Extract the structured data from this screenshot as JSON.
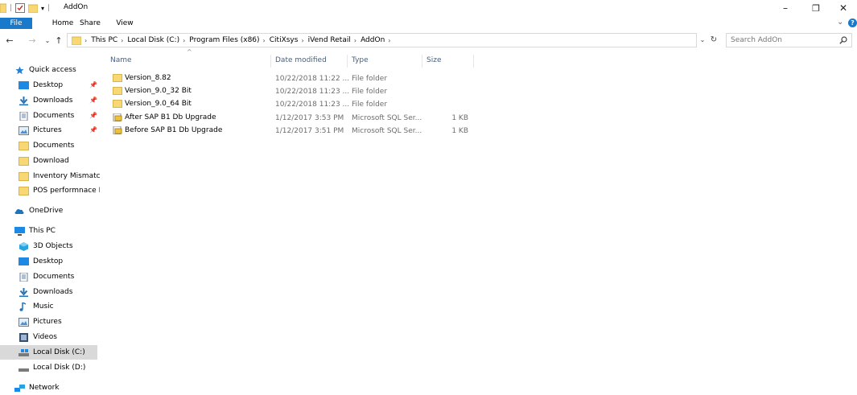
{
  "window": {
    "title": "AddOn",
    "minimize": "–",
    "maximize": "❐",
    "close": "✕"
  },
  "ribbon": {
    "tabs": [
      "File",
      "Home",
      "Share",
      "View"
    ],
    "expand": "⌄",
    "help": "?"
  },
  "nav": {
    "back": "←",
    "forward": "→",
    "recent": "⌄",
    "up": "↑"
  },
  "address": {
    "crumbs": [
      "This PC",
      "Local Disk (C:)",
      "Program Files (x86)",
      "CitiXsys",
      "iVend Retail",
      "AddOn"
    ],
    "sep": "›",
    "dropdown": "⌄",
    "refresh": "↻"
  },
  "search": {
    "placeholder": "Search AddOn",
    "value": ""
  },
  "sidebar": {
    "items": [
      {
        "label": "Quick access",
        "icon": "star-icon",
        "pin": ""
      },
      {
        "label": "Desktop",
        "icon": "desktop-icon",
        "pin": "📌"
      },
      {
        "label": "Downloads",
        "icon": "download-icon",
        "pin": "📌"
      },
      {
        "label": "Documents",
        "icon": "documents-icon",
        "pin": "📌"
      },
      {
        "label": "Pictures",
        "icon": "pictures-icon",
        "pin": "📌"
      },
      {
        "label": "Documents",
        "icon": "folder-icon",
        "pin": ""
      },
      {
        "label": "Download",
        "icon": "folder-icon",
        "pin": ""
      },
      {
        "label": "Inventory Mismatch",
        "icon": "folder-icon",
        "pin": ""
      },
      {
        "label": "POS performnace Is",
        "icon": "folder-icon",
        "pin": ""
      },
      {
        "label": "OneDrive",
        "icon": "onedrive-icon",
        "pin": ""
      },
      {
        "label": "This PC",
        "icon": "thispc-icon",
        "pin": ""
      },
      {
        "label": "3D Objects",
        "icon": "3d-objects-icon",
        "pin": ""
      },
      {
        "label": "Desktop",
        "icon": "desktop-icon",
        "pin": ""
      },
      {
        "label": "Documents",
        "icon": "documents-icon",
        "pin": ""
      },
      {
        "label": "Downloads",
        "icon": "download-icon",
        "pin": ""
      },
      {
        "label": "Music",
        "icon": "music-icon",
        "pin": ""
      },
      {
        "label": "Pictures",
        "icon": "pictures-icon",
        "pin": ""
      },
      {
        "label": "Videos",
        "icon": "videos-icon",
        "pin": ""
      },
      {
        "label": "Local Disk (C:)",
        "icon": "drive-icon",
        "pin": ""
      },
      {
        "label": "Local Disk (D:)",
        "icon": "drive-icon",
        "pin": ""
      },
      {
        "label": "Network",
        "icon": "network-icon",
        "pin": ""
      }
    ]
  },
  "columns": {
    "name": "Name",
    "date": "Date modified",
    "type": "Type",
    "size": "Size",
    "sort": "^"
  },
  "files": [
    {
      "name": "Version_8.82",
      "date": "10/22/2018 11:22 ...",
      "type": "File folder",
      "size": "",
      "icon": "folder-icon"
    },
    {
      "name": "Version_9.0_32 Bit",
      "date": "10/22/2018 11:23 ...",
      "type": "File folder",
      "size": "",
      "icon": "folder-icon"
    },
    {
      "name": "Version_9.0_64 Bit",
      "date": "10/22/2018 11:23 ...",
      "type": "File folder",
      "size": "",
      "icon": "folder-icon"
    },
    {
      "name": "After SAP B1 Db Upgrade",
      "date": "1/12/2017 3:53 PM",
      "type": "Microsoft SQL Ser...",
      "size": "1 KB",
      "icon": "sql-file-icon"
    },
    {
      "name": "Before SAP B1 Db Upgrade",
      "date": "1/12/2017 3:51 PM",
      "type": "Microsoft SQL Ser...",
      "size": "1 KB",
      "icon": "sql-file-icon"
    }
  ],
  "colors": {
    "accent": "#1979ca",
    "folder": "#f8d775",
    "selected": "#d9d9d9",
    "header_text": "#4c607a"
  }
}
